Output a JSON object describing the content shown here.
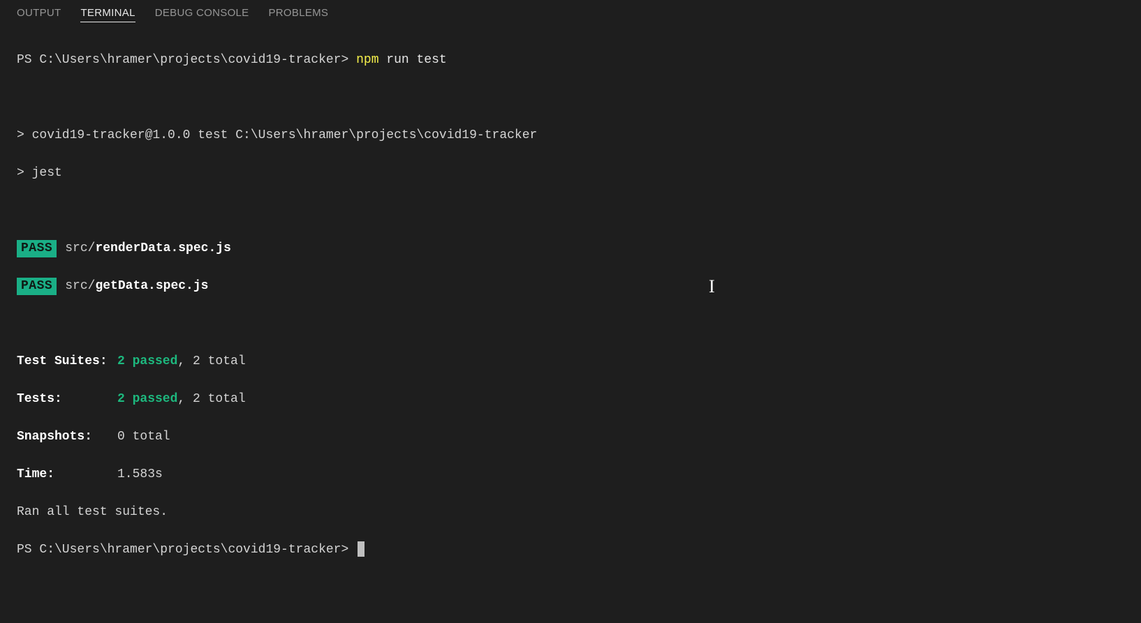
{
  "tabs": {
    "output": "OUTPUT",
    "terminal": "TERMINAL",
    "debug_console": "DEBUG CONSOLE",
    "problems": "PROBLEMS"
  },
  "line1": {
    "prompt": "PS C:\\Users\\hramer\\projects\\covid19-tracker> ",
    "cmd1": "npm",
    "cmd2": " run test"
  },
  "line2": "> covid19-tracker@1.0.0 test C:\\Users\\hramer\\projects\\covid19-tracker",
  "line3": "> jest",
  "pass_badge": "PASS",
  "pass1": {
    "dir": "src/",
    "file": "renderData.spec.js"
  },
  "pass2": {
    "dir": "src/",
    "file": "getData.spec.js"
  },
  "summary": {
    "suites_label": "Test Suites:",
    "suites_passed": "2 passed",
    "suites_total": ", 2 total",
    "tests_label": "Tests:",
    "tests_passed": "2 passed",
    "tests_total": ", 2 total",
    "snapshots_label": "Snapshots:",
    "snapshots_val": "0 total",
    "time_label": "Time:",
    "time_val": "1.583s"
  },
  "ran_all": "Ran all test suites.",
  "final_prompt": "PS C:\\Users\\hramer\\projects\\covid19-tracker> "
}
